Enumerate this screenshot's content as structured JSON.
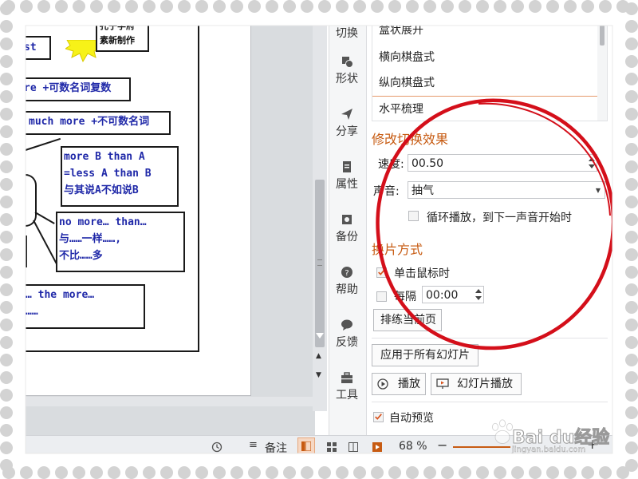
{
  "slide": {
    "boxes": {
      "top_right": [
        "孔子学府",
        "素新制作"
      ],
      "st": "st",
      "re": "re +可数名词复数",
      "much": "much more +不可数名词",
      "more_b": [
        "more B than A",
        "=less A than B",
        "与其说A不如说B"
      ],
      "no_more": [
        "no more… than…",
        "与……一样……,",
        "不比……多"
      ],
      "the_more": [
        "… the more…",
        "……"
      ]
    }
  },
  "tools": [
    {
      "label": "切换",
      "icon": "transition-icon"
    },
    {
      "label": "形状",
      "icon": "shape-icon"
    },
    {
      "label": "分享",
      "icon": "share-icon"
    },
    {
      "label": "属性",
      "icon": "properties-icon"
    },
    {
      "label": "备份",
      "icon": "backup-icon"
    },
    {
      "label": "帮助",
      "icon": "help-icon"
    },
    {
      "label": "反馈",
      "icon": "feedback-icon"
    },
    {
      "label": "工具",
      "icon": "toolbox-icon"
    }
  ],
  "pane": {
    "effects": [
      "盒状展开",
      "横向棋盘式",
      "纵向棋盘式",
      "水平梳理"
    ],
    "modify_title": "修改切换效果",
    "speed_label": "速度:",
    "speed_value": "00.50",
    "sound_label": "声音:",
    "sound_value": "抽气",
    "loop_label": "循环播放，到下一声音开始时",
    "advance_title": "换片方式",
    "on_click_label": "单击鼠标时",
    "every_label": "每隔",
    "every_value": "00:00",
    "rehearse_label": "排练当前页",
    "apply_all_label": "应用于所有幻灯片",
    "play_label": "播放",
    "slideshow_label": "幻灯片播放",
    "auto_preview_label": "自动预览"
  },
  "status": {
    "notes_label": "备注",
    "zoom": "68 %",
    "zoom_level": 0.68
  },
  "watermark": {
    "text": "Bai du经验",
    "sub": "jingyan.baidu.com"
  },
  "colors": {
    "accent": "#c75b12",
    "circle": "#d40f1a",
    "slide_text": "#1f28a8",
    "check": "#d9541e"
  }
}
